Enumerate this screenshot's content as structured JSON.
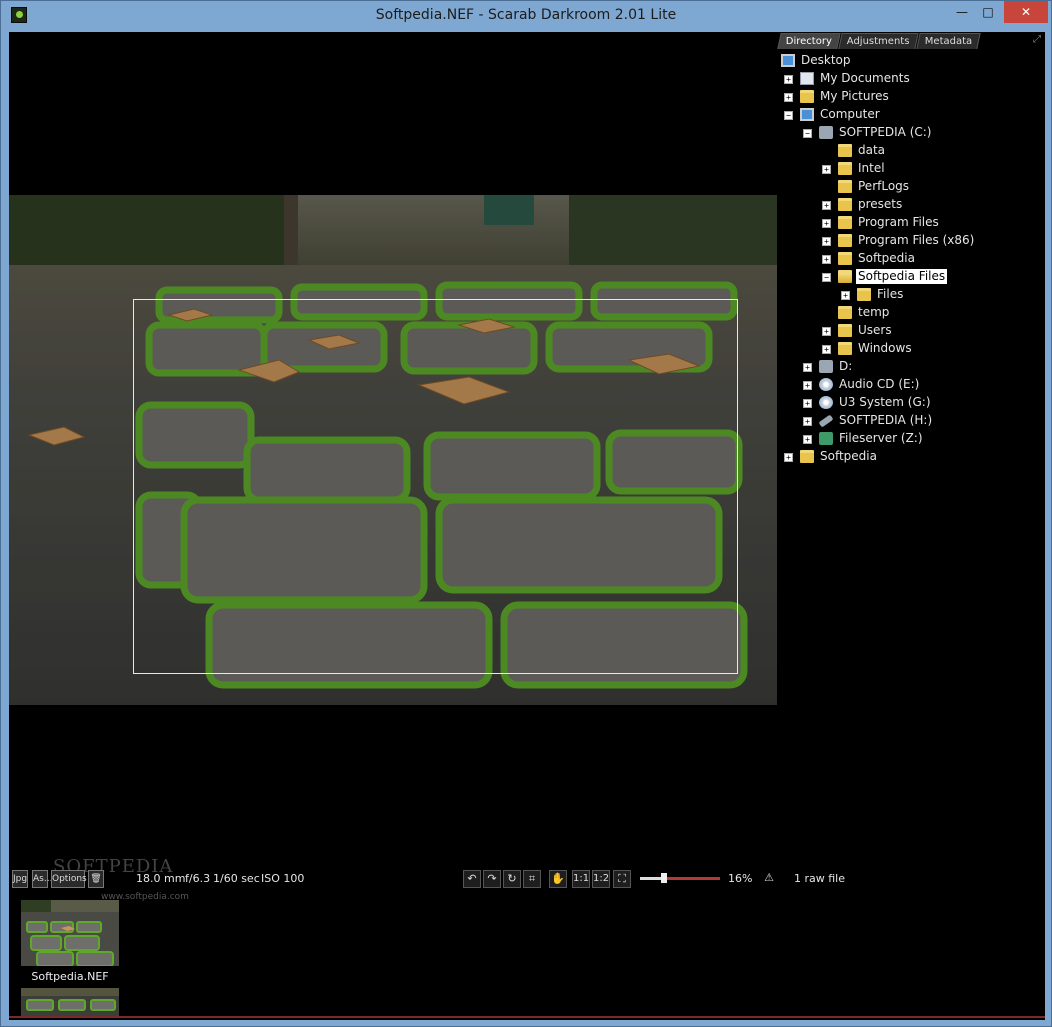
{
  "window": {
    "title": "Softpedia.NEF - Scarab Darkroom 2.01 Lite",
    "controls": {
      "minimize": "—",
      "maximize": "□",
      "close": "✕"
    }
  },
  "panel": {
    "tabs": [
      {
        "label": "Directory",
        "active": true
      },
      {
        "label": "Adjustments",
        "active": false
      },
      {
        "label": "Metadata",
        "active": false
      }
    ],
    "tree": [
      {
        "label": "Desktop",
        "icon": "desktop-icon",
        "expander": ""
      },
      {
        "label": "My Documents",
        "icon": "documents-icon",
        "expander": "+"
      },
      {
        "label": "My Pictures",
        "icon": "pictures-icon",
        "expander": "+"
      },
      {
        "label": "Computer",
        "icon": "computer-icon",
        "expander": "−"
      },
      {
        "label": "SOFTPEDIA (C:)",
        "icon": "drive-icon",
        "expander": "−"
      },
      {
        "label": "data",
        "icon": "folder-icon",
        "expander": ""
      },
      {
        "label": "Intel",
        "icon": "folder-icon",
        "expander": "+"
      },
      {
        "label": "PerfLogs",
        "icon": "folder-icon",
        "expander": ""
      },
      {
        "label": "presets",
        "icon": "folder-icon",
        "expander": "+"
      },
      {
        "label": "Program Files",
        "icon": "folder-icon",
        "expander": "+"
      },
      {
        "label": "Program Files (x86)",
        "icon": "folder-icon",
        "expander": "+"
      },
      {
        "label": "Softpedia",
        "icon": "folder-icon",
        "expander": "+"
      },
      {
        "label": "Softpedia Files",
        "icon": "folder-open-icon",
        "expander": "−",
        "selected": true
      },
      {
        "label": "Files",
        "icon": "folder-icon",
        "expander": "+"
      },
      {
        "label": "temp",
        "icon": "folder-icon",
        "expander": ""
      },
      {
        "label": "Users",
        "icon": "folder-icon",
        "expander": "+"
      },
      {
        "label": "Windows",
        "icon": "folder-icon",
        "expander": "+"
      },
      {
        "label": "D:",
        "icon": "drive-icon",
        "expander": "+"
      },
      {
        "label": "Audio CD (E:)",
        "icon": "cd-icon",
        "expander": "+"
      },
      {
        "label": "U3 System (G:)",
        "icon": "cd-icon",
        "expander": "+"
      },
      {
        "label": "SOFTPEDIA (H:)",
        "icon": "usb-drive-icon",
        "expander": "+"
      },
      {
        "label": "Fileserver (Z:)",
        "icon": "network-drive-icon",
        "expander": "+"
      },
      {
        "label": "Softpedia",
        "icon": "folder-icon",
        "expander": "+"
      }
    ]
  },
  "toolbar": {
    "jpg_label": "Jpg",
    "save_as_label": "As...",
    "options_label": "Options",
    "focal_length": "18.0 mm",
    "aperture": "f/6.3",
    "shutter": "1/60 sec",
    "iso": "ISO 100",
    "zoom_1_1": "1:1",
    "zoom_1_2": "1:2",
    "zoom_percent": "16%",
    "zoom_level": 0.16,
    "file_count": "1 raw file",
    "tools": [
      "rotate-left-icon",
      "rotate-right-icon",
      "reset-rotate-icon",
      "crop-icon",
      "hand-icon",
      "fit-icon",
      "warning-icon"
    ]
  },
  "watermark": {
    "name": "SOFTPEDIA",
    "url": "www.softpedia.com"
  },
  "thumbnails": [
    {
      "label": "Softpedia.NEF"
    }
  ],
  "colors": {
    "background": "#000000",
    "titlebar": "#7ea7d1",
    "close": "#c7453a",
    "accent": "#b43a3a"
  }
}
